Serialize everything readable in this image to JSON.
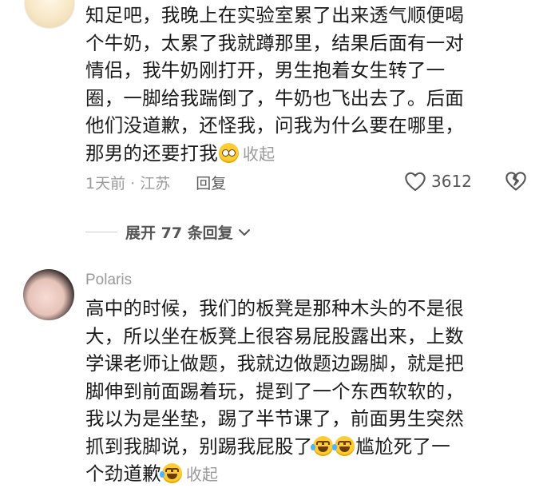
{
  "comments": [
    {
      "lines": [
        "知足吧，我晚上在实验室累了出来透气顺便喝",
        "个牛奶，太累了我就蹲那里，结果后面有一对",
        "情侣，我牛奶刚打开，男生抱着女生转了一",
        "圈，一脚给我踹倒了，牛奶也飞出去了。后面",
        "他们没道歉，还怪我，问我为什么要在哪里，",
        "那男的还要打我"
      ],
      "collapse_label": "收起",
      "time": "1天前",
      "separator": "·",
      "location": "江苏",
      "reply_label": "回复",
      "like_count": "3612",
      "expand_label": "展开 77 条回复"
    },
    {
      "username": "Polaris",
      "lines": [
        "高中的时候，我们的板凳是那种木头的不是很",
        "大，所以坐在板凳上很容易屁股露出来，上数",
        "学课老师让做题，我就边做题边踢脚，就是把",
        "脚伸到前面踢着玩，提到了一个东西软软的，",
        "我以为是坐垫，踢了半节课了，前面男生突然",
        "抓到我脚说，别踢我屁股了",
        "尴尬死了一",
        "个劲道歉"
      ],
      "collapse_label": "收起"
    }
  ],
  "icons": {
    "emoji_shy": "blushing-face-emoji",
    "emoji_laugh": "laughing-crying-emoji",
    "like": "heart-outline-icon",
    "dislike": "broken-heart-icon",
    "chevron": "chevron-down-icon"
  },
  "colors": {
    "text": "#1a1a1a",
    "muted": "#9a9a9a",
    "emoji": "#ffcc33"
  }
}
